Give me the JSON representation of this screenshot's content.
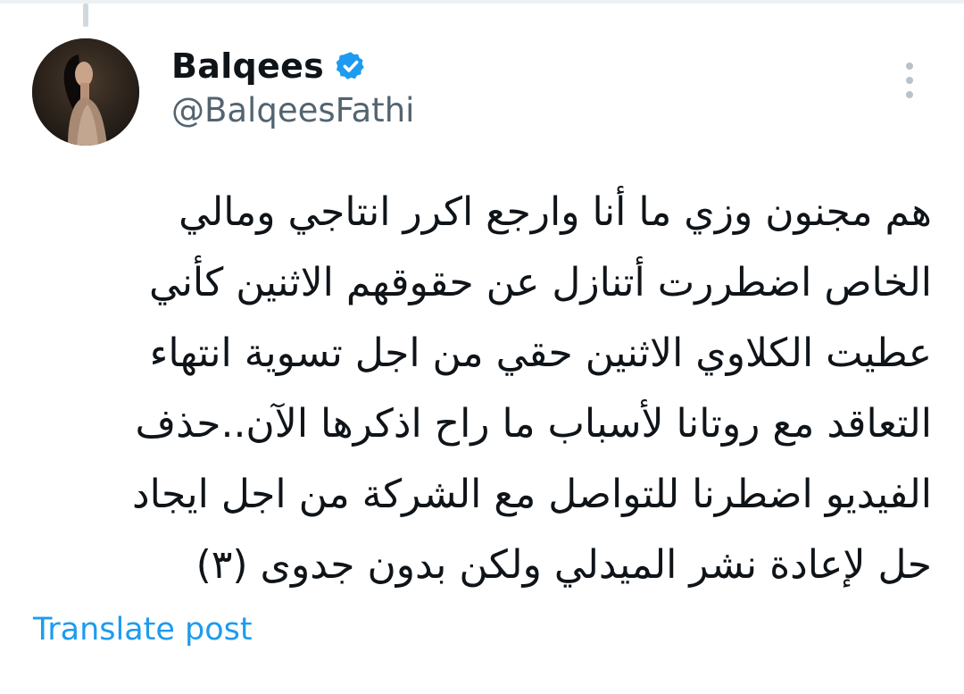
{
  "post": {
    "author": {
      "display_name": "Balqees",
      "handle": "@BalqeesFathi",
      "verified": true,
      "verified_icon": "verified-badge-icon",
      "avatar_icon": "profile-avatar"
    },
    "menu_icon": "more-vertical-icon",
    "text_lines": [
      "هم مجنون وزي ما أنا وارجع اكرر انتاجي ومالي",
      "الخاص اضطررت أتنازل عن حقوقهم الاثنين كأني",
      "عطيت الكلاوي الاثنين حقي من اجل تسوية انتهاء",
      "التعاقد مع روتانا لأسباب ما راح اذكرها الآن..حذف",
      "الفيديو اضطرنا للتواصل مع الشركة من اجل ايجاد",
      "حل لإعادة نشر الميدلي ولكن بدون جدوى (٣)"
    ],
    "translate_label": "Translate post"
  },
  "colors": {
    "text_primary": "#0f1419",
    "text_secondary": "#536471",
    "accent": "#1d9bf0",
    "thread_line": "#cfd9de"
  }
}
